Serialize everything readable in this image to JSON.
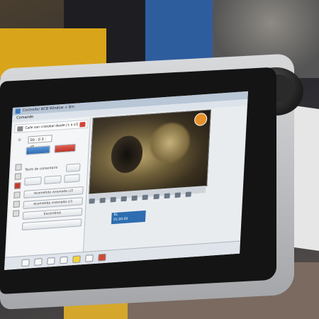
{
  "window": {
    "title": "Controller BCB Window + Bin"
  },
  "menu": {
    "items": [
      "Comando"
    ]
  },
  "left_panel": {
    "header": "Calle san cristobal desde j'c a c/2",
    "counter": "00 : 0 3 : 45",
    "comment_label": "Texto de comentario",
    "buttons": [
      "Acometida visionada c/2",
      "Acometida visionada c/1",
      "Escombros"
    ]
  },
  "status": {
    "line1": "BL",
    "line2": "01:00.00"
  },
  "colors": {
    "accent_blue": "#2d6db0",
    "record_red": "#c73a2f",
    "camera_logo": "#e5902a"
  },
  "icons": {
    "bottom_bar": [
      "settings-icon",
      "network-icon",
      "image-icon",
      "video-icon",
      "warning-icon",
      "pause-icon",
      "bug-icon"
    ]
  }
}
